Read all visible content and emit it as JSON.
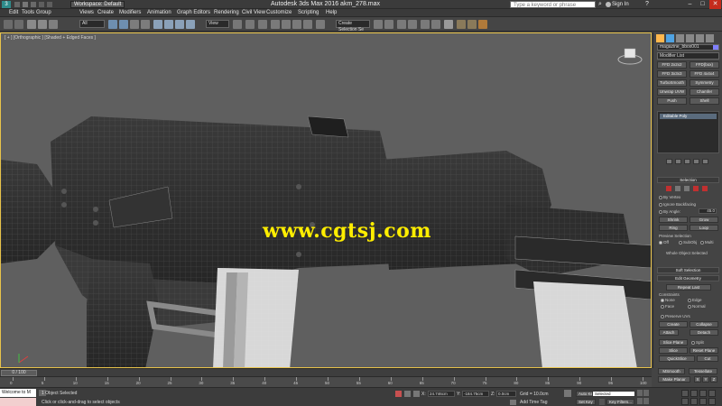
{
  "titlebar": {
    "workspace": "Workspace: Default",
    "app_title": "Autodesk 3ds Max 2016     akm_278.max",
    "search_placeholder": "Type a keyword or phrase",
    "sign_in": "Sign In"
  },
  "menu": [
    "Edit",
    "Tools",
    "Group",
    "Views",
    "Create",
    "Modifiers",
    "Animation",
    "Graph Editors",
    "Rendering",
    "Civil View",
    "Customize",
    "Scripting",
    "Help"
  ],
  "toolbar": {
    "selection_filter": "All",
    "ref_coord": "View",
    "named_selection": "Create Selection Se"
  },
  "viewport": {
    "label": "[ + ] [Orthographic ] [Shaded + Edged Faces ]",
    "watermark": "www.cgtsj.com"
  },
  "command_panel": {
    "object_name": "magazine_bbox001",
    "modifier_list": "Modifier List",
    "modifier_buttons": [
      "FFD 2x2x2",
      "FFD(box)",
      "FFD 3x3x3",
      "FFD 4x4x4",
      "TurboSmooth",
      "Symmetry",
      "Unwrap UVW",
      "Chamfer",
      "Push",
      "Shell"
    ],
    "stack_entry": "Editable Poly",
    "rollouts": {
      "selection": "Selection",
      "by_vertex": "By Vertex",
      "ignore_backfacing": "Ignore Backfacing",
      "by_angle": "By Angle:",
      "angle_value": "45.0",
      "shrink": "Shrink",
      "grow": "Grow",
      "ring": "Ring",
      "loop": "Loop",
      "preview_selection": "Preview Selection",
      "off": "Off",
      "subobj": "SubObj",
      "multi": "Multi",
      "selected_status": "Whole Object Selected",
      "soft_selection": "Soft Selection",
      "edit_geometry": "Edit Geometry",
      "repeat_last": "Repeat Last",
      "constraints": "Constraints",
      "none": "None",
      "edge": "Edge",
      "face": "Face",
      "normal": "Normal",
      "preserve_uvs": "Preserve UVs",
      "create": "Create",
      "collapse": "Collapse",
      "attach": "Attach",
      "detach": "Detach",
      "slice_plane": "Slice Plane",
      "split": "Split",
      "slice": "Slice",
      "reset_plane": "Reset Plane",
      "quickslice": "QuickSlice",
      "cut": "Cut",
      "msmooth": "MSmooth",
      "tessellate": "Tessellate",
      "make_planar": "Make Planar",
      "x": "X",
      "y": "Y",
      "z": "Z"
    }
  },
  "timeline": {
    "frame": "0 / 100",
    "ticks": [
      "0",
      "5",
      "10",
      "15",
      "20",
      "25",
      "30",
      "35",
      "40",
      "45",
      "50",
      "55",
      "60",
      "65",
      "70",
      "75",
      "80",
      "85",
      "90",
      "95",
      "100"
    ]
  },
  "status": {
    "maxscript": "Welcome to M",
    "selection": "1 Object Selected",
    "prompt": "Click or click-and-drag to select objects",
    "x_label": "X:",
    "x_value": "24.746cm",
    "y_label": "Y:",
    "y_value": "-184.75cm",
    "z_label": "Z:",
    "z_value": "0.0cm",
    "grid": "Grid = 10.0cm",
    "add_time_tag": "Add Time Tag",
    "auto_key": "Auto Key",
    "auto_key_value": "Selected",
    "set_key": "Set Key",
    "key_filters": "Key Filters...",
    "frame_value": "0"
  },
  "colors": {
    "viewport_border": "#e8c34a",
    "watermark": "#ffee00",
    "auto_key_red": "#c02020"
  }
}
